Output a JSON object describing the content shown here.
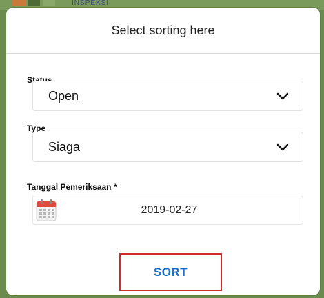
{
  "background": {
    "label": "INSPEKSI"
  },
  "modal": {
    "title": "Select sorting here",
    "status": {
      "label": "Status",
      "value": "Open"
    },
    "type": {
      "label": "Type",
      "value": "Siaga"
    },
    "date": {
      "label": "Tanggal Pemeriksaan *",
      "value": "2019-02-27"
    },
    "sort_label": "SORT"
  },
  "icons": {
    "status_chevron": "chevron-down-icon",
    "type_chevron": "chevron-down-icon",
    "calendar": "calendar-icon"
  },
  "colors": {
    "accent": "#1a6fd1",
    "highlight_border": "#d62828",
    "calendar_red": "#e04a3c"
  }
}
